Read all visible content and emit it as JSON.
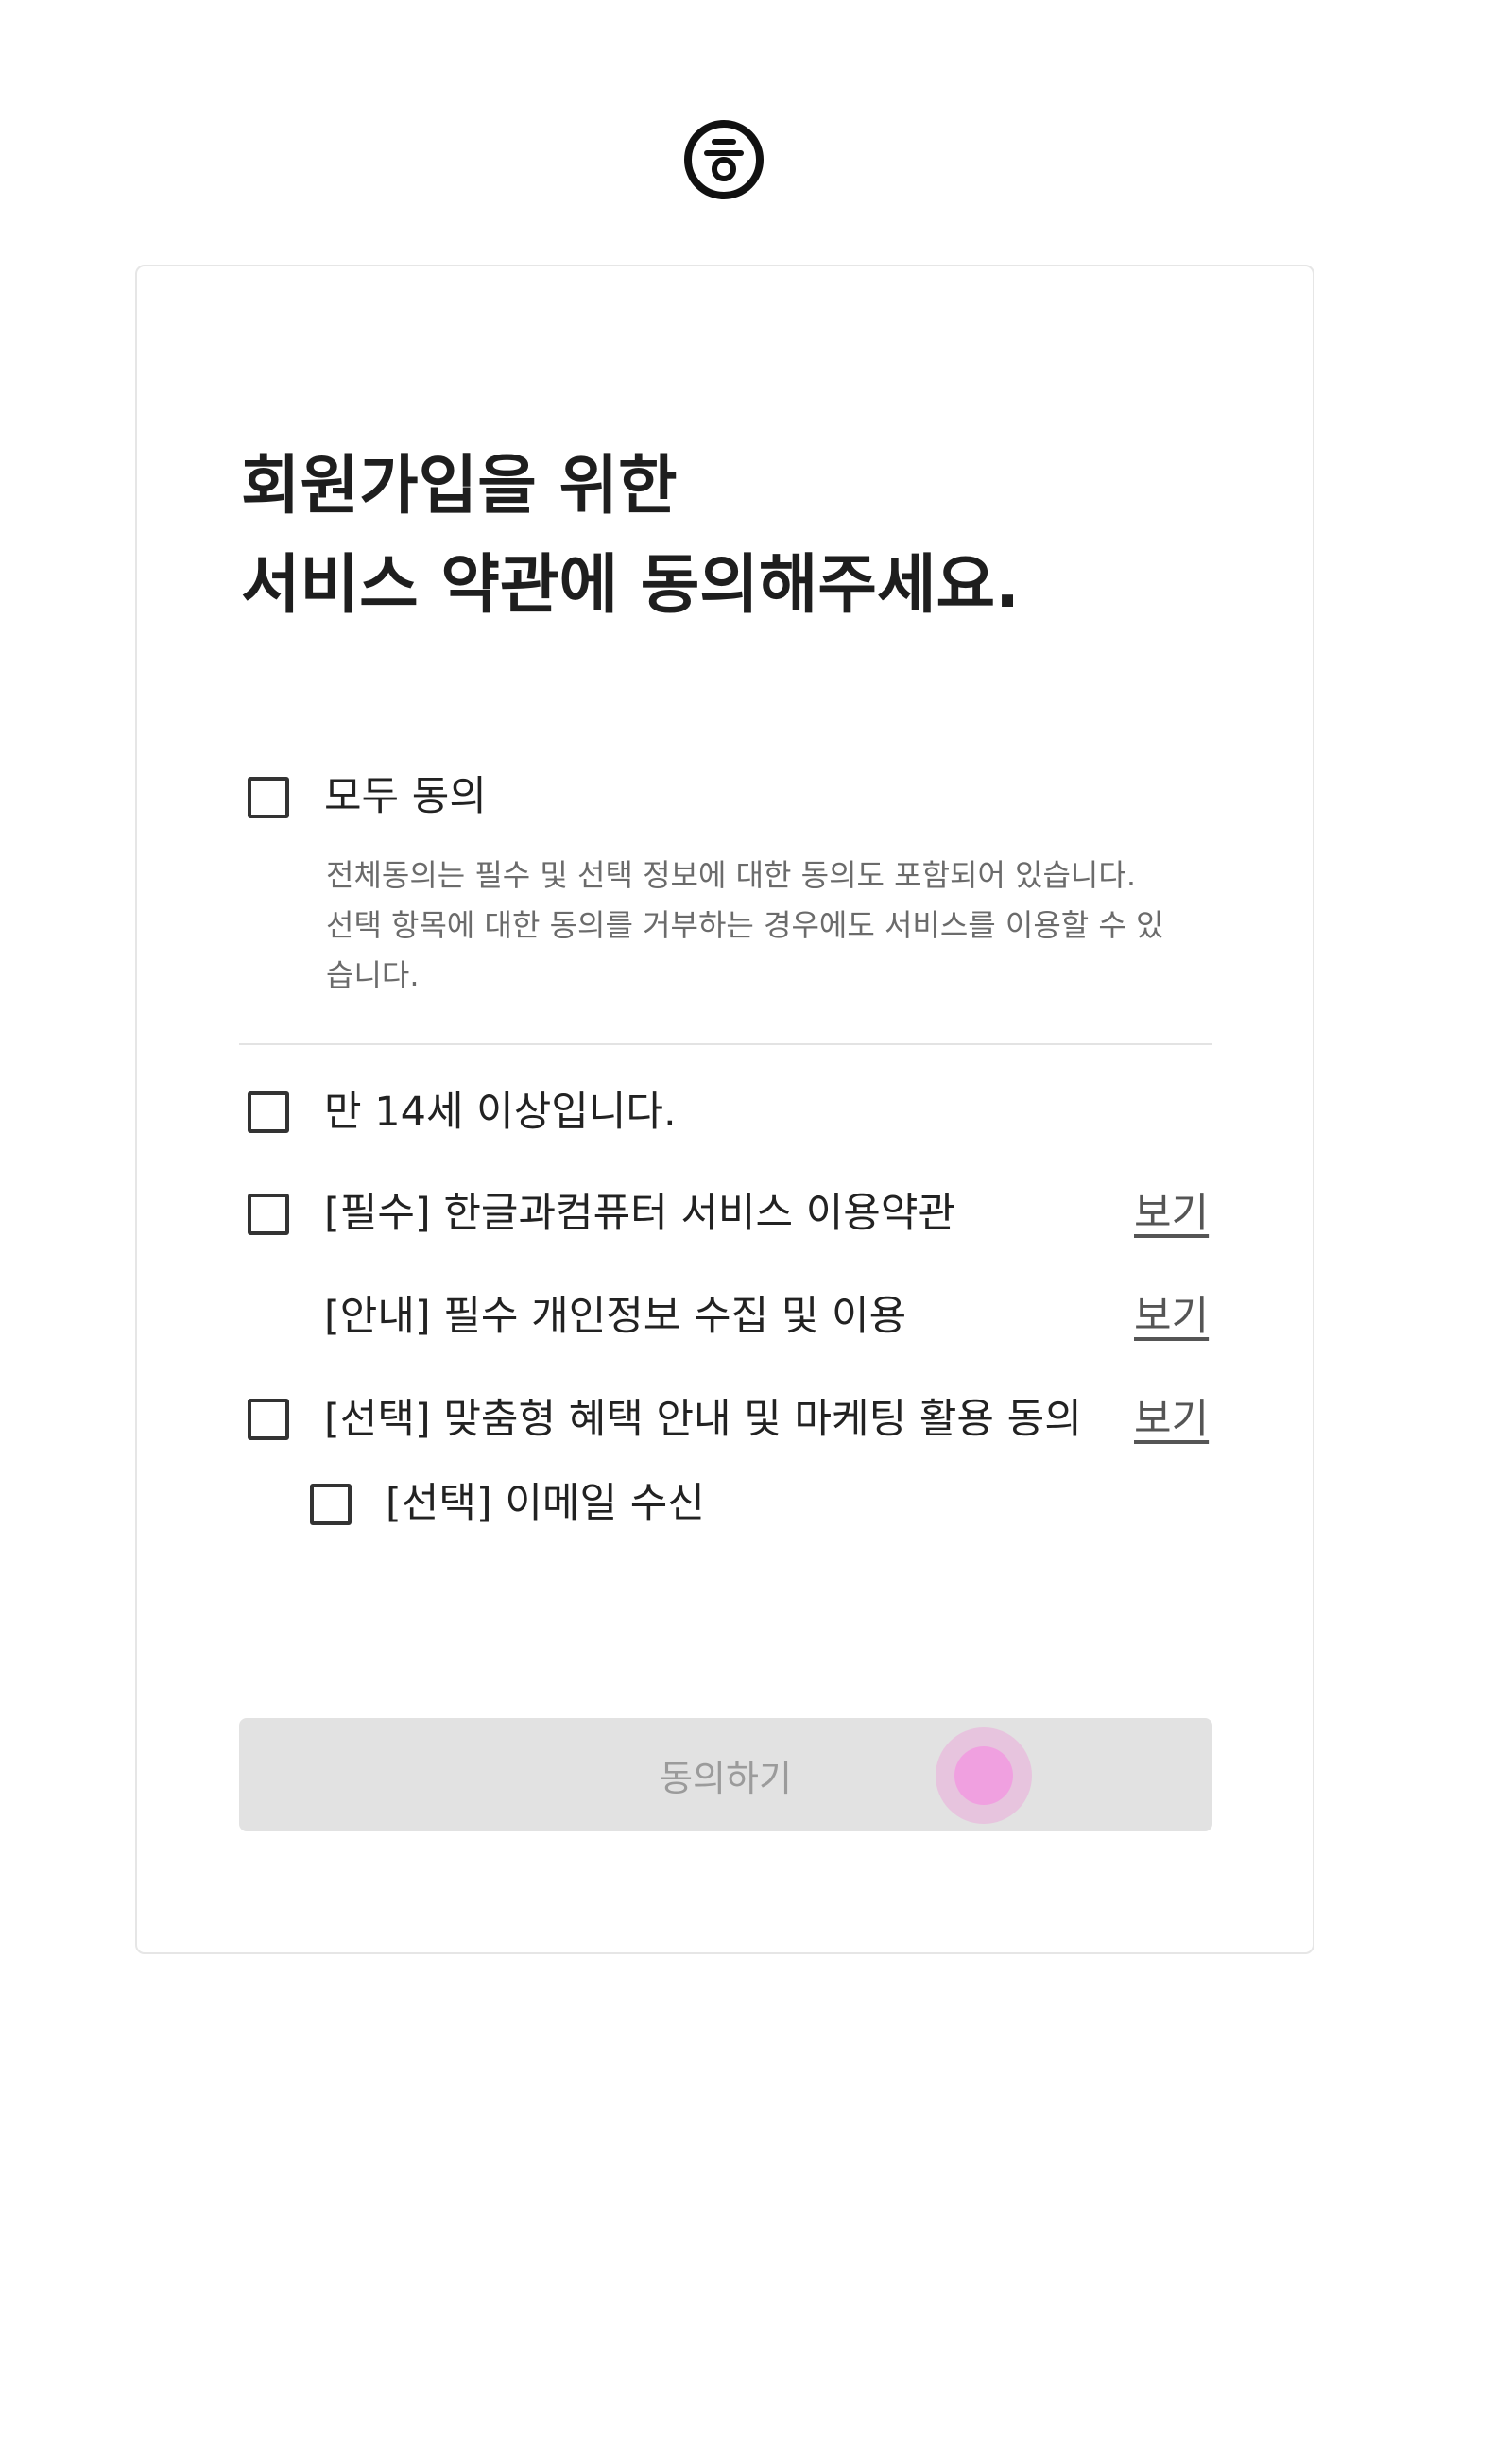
{
  "title": {
    "line1": "회원가입을 위한",
    "line2": "서비스 약관에 동의해주세요."
  },
  "agree_all": {
    "label": "모두 동의",
    "checked": false,
    "description": [
      "전체동의는 필수 및 선택 정보에 대한 동의도 포함되어 있습니다.",
      "선택 항목에 대한 동의를 거부하는 경우에도 서비스를 이용할 수 있",
      "습니다."
    ]
  },
  "items": [
    {
      "label": "만 14세 이상입니다.",
      "checked": false
    },
    {
      "label": "[필수] 한글과컴퓨터 서비스 이용약관",
      "checked": false,
      "link": "보기"
    },
    {
      "label": "[안내] 필수 개인정보 수집 및 이용",
      "link": "보기"
    },
    {
      "label": "[선택] 맞춤형 혜택 안내 및 마케팅 활용 동의",
      "checked": false,
      "link": "보기"
    },
    {
      "label": "[선택] 이메일 수신",
      "checked": false
    }
  ],
  "submit_button": {
    "label": "동의하기",
    "enabled": false
  },
  "colors": {
    "button_disabled_bg": "#e2e2e2",
    "button_disabled_text": "#9b9b9b",
    "touch_indicator": "#f0a0e0"
  },
  "icons": {
    "logo": "hancom-circle-logo-icon"
  }
}
